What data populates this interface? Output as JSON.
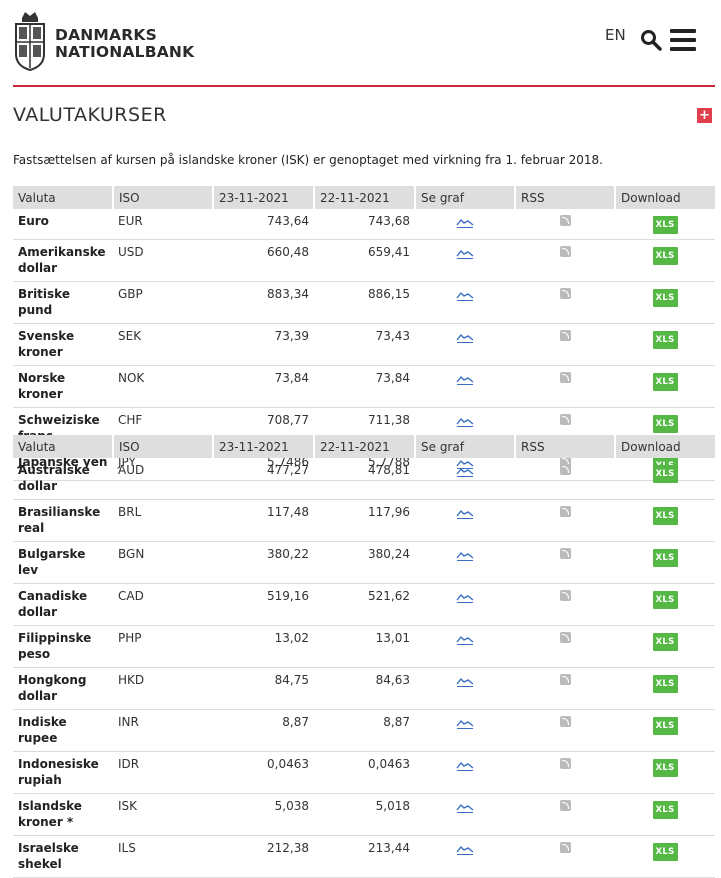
{
  "header": {
    "brand_line1": "DANMARKS",
    "brand_line2": "NATIONALBANK",
    "language": "EN",
    "accent_color": "#c8283e"
  },
  "page": {
    "title": "VALUTAKURSER",
    "notice": "Fastsættelsen af kursen på islandske kroner (ISK) er genoptaget med virkning fra 1. februar 2018."
  },
  "table_headers": [
    "Valuta",
    "ISO",
    "23-11-2021",
    "22-11-2021",
    "Se graf",
    "RSS",
    "Download"
  ],
  "download_label": "XLS",
  "tables": [
    {
      "rows": [
        {
          "name": "Euro",
          "iso": "EUR",
          "d1": "743,64",
          "d2": "743,68"
        },
        {
          "name": "Amerikanske dollar",
          "iso": "USD",
          "d1": "660,48",
          "d2": "659,41"
        },
        {
          "name": "Britiske pund",
          "iso": "GBP",
          "d1": "883,34",
          "d2": "886,15"
        },
        {
          "name": "Svenske kroner",
          "iso": "SEK",
          "d1": "73,39",
          "d2": "73,43"
        },
        {
          "name": "Norske kroner",
          "iso": "NOK",
          "d1": "73,84",
          "d2": "73,84"
        },
        {
          "name": "Schweiziske franc",
          "iso": "CHF",
          "d1": "708,77",
          "d2": "711,38"
        },
        {
          "name": "Japanske yen",
          "iso": "JPY",
          "d1": "5,7486",
          "d2": "5,7788"
        }
      ]
    },
    {
      "rows": [
        {
          "name": "Australske dollar",
          "iso": "AUD",
          "d1": "477,27",
          "d2": "478,81"
        },
        {
          "name": "Brasilianske real",
          "iso": "BRL",
          "d1": "117,48",
          "d2": "117,96"
        },
        {
          "name": "Bulgarske lev",
          "iso": "BGN",
          "d1": "380,22",
          "d2": "380,24"
        },
        {
          "name": "Canadiske dollar",
          "iso": "CAD",
          "d1": "519,16",
          "d2": "521,62"
        },
        {
          "name": "Filippinske peso",
          "iso": "PHP",
          "d1": "13,02",
          "d2": "13,01"
        },
        {
          "name": "Hongkong dollar",
          "iso": "HKD",
          "d1": "84,75",
          "d2": "84,63"
        },
        {
          "name": "Indiske rupee",
          "iso": "INR",
          "d1": "8,87",
          "d2": "8,87"
        },
        {
          "name": "Indonesiske rupiah",
          "iso": "IDR",
          "d1": "0,0463",
          "d2": "0,0463"
        },
        {
          "name": "Islandske kroner *",
          "iso": "ISK",
          "d1": "5,038",
          "d2": "5,018"
        },
        {
          "name": "Israelske shekel",
          "iso": "ILS",
          "d1": "212,38",
          "d2": "213,44"
        }
      ]
    }
  ]
}
